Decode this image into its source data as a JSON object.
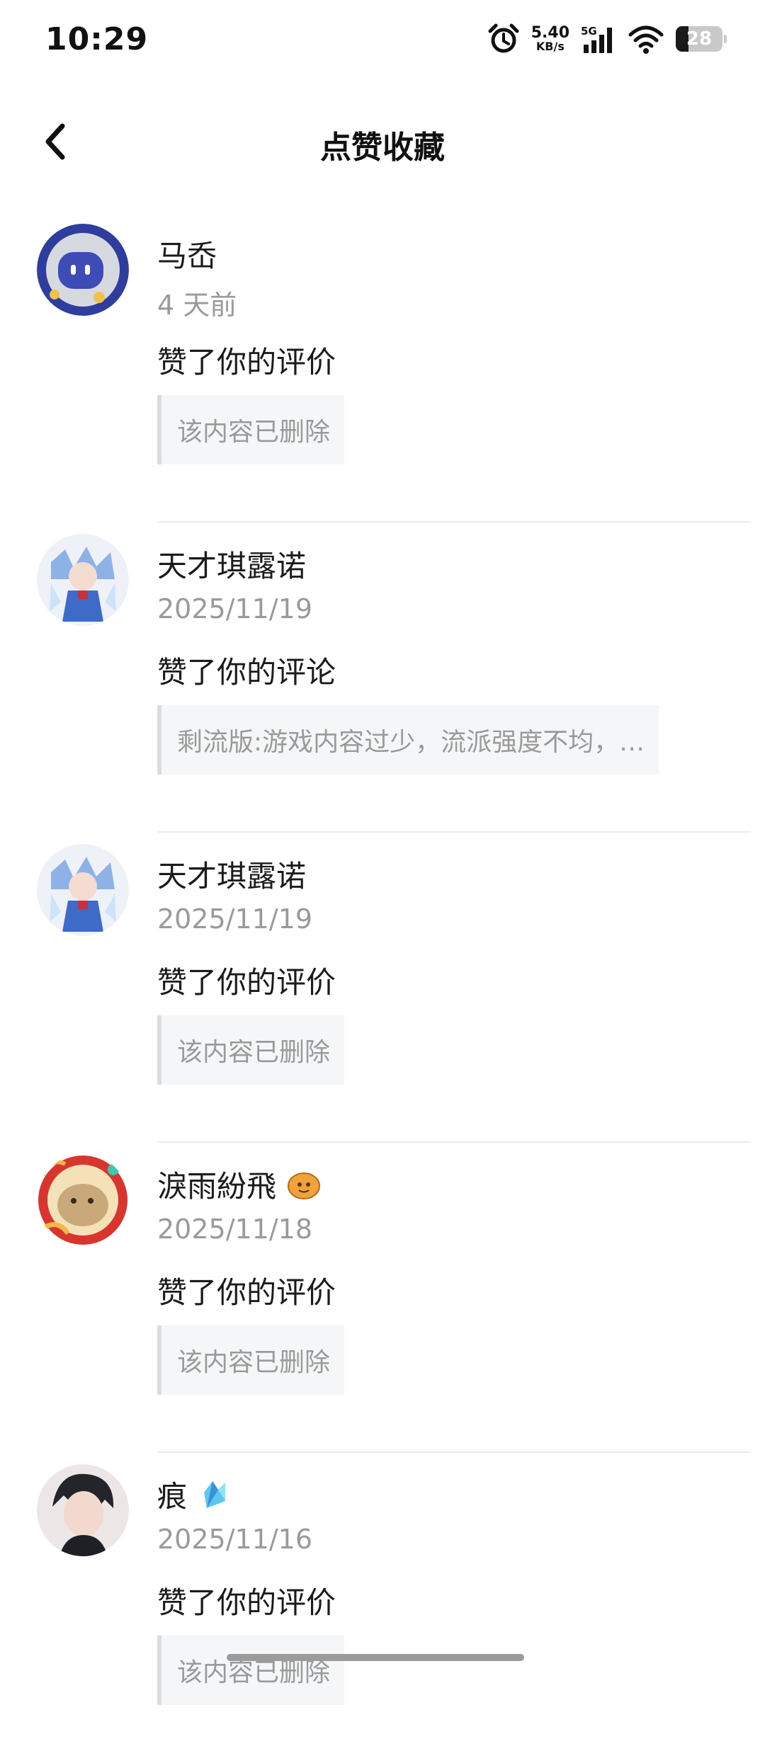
{
  "status": {
    "time": "10:29",
    "net_speed": "5.40",
    "net_unit": "KB/s",
    "network": "5G",
    "battery": "28"
  },
  "header": {
    "title": "点赞收藏",
    "back_icon": "chevron-left-icon"
  },
  "items": [
    {
      "name": "马岙",
      "time": "4 天前",
      "action": "赞了你的评价",
      "quote": "该内容已删除",
      "badge": null
    },
    {
      "name": "天才琪露诺",
      "time": "2025/11/19",
      "action": "赞了你的评论",
      "quote": "剩流版:游戏内容过少，流派强度不均，…",
      "badge": null
    },
    {
      "name": "天才琪露诺",
      "time": "2025/11/19",
      "action": "赞了你的评价",
      "quote": "该内容已删除",
      "badge": null
    },
    {
      "name": "淚雨紛飛",
      "time": "2025/11/18",
      "action": "赞了你的评价",
      "quote": "该内容已删除",
      "badge": "orange-blob-badge-icon"
    },
    {
      "name": "痕",
      "time": "2025/11/16",
      "action": "赞了你的评价",
      "quote": "该内容已删除",
      "badge": "blue-crystal-badge-icon"
    }
  ]
}
